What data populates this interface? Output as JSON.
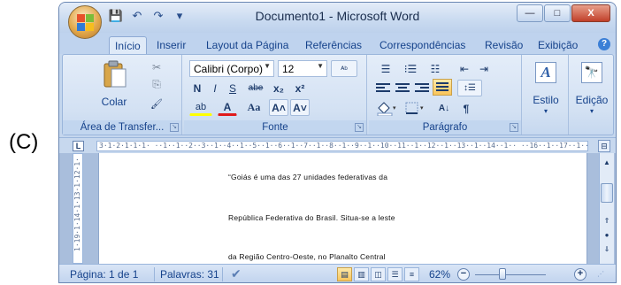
{
  "caption": "(C)",
  "window": {
    "title": "Documento1 - Microsoft Word",
    "minimize": "—",
    "maximize": "□",
    "close": "X"
  },
  "qat": {
    "save": "💾",
    "undo": "↶",
    "redo": "↷",
    "customize": "▾"
  },
  "tabs": [
    "Início",
    "Inserir",
    "Layout da Página",
    "Referências",
    "Correspondências",
    "Revisão",
    "Exibição"
  ],
  "help": "?",
  "clipboard": {
    "paste_label": "Colar",
    "group_label": "Área de Transfer...",
    "cut": "✂",
    "copy": "⎘",
    "format_painter": "🖌"
  },
  "font": {
    "family": "Calibri (Corpo)",
    "size": "12",
    "bold": "N",
    "italic": "I",
    "underline": "S",
    "strike": "abe",
    "subscript": "x₂",
    "superscript": "x²",
    "change_case": "Aa",
    "grow": "A˄",
    "shrink": "A˅",
    "highlight": "ab",
    "font_color": "A",
    "clear": "ᴬᵇ",
    "group_label": "Fonte"
  },
  "paragraph": {
    "group_label": "Parágrafo",
    "bullets": "☰",
    "numbering": "⁝☰",
    "multilevel": "☷",
    "decrease_indent": "⇤",
    "increase_indent": "⇥",
    "sort": "A↓",
    "show_marks": "¶",
    "line_spacing": "↕☰"
  },
  "styles": {
    "label": "Estilo",
    "icon": "A"
  },
  "editing": {
    "label": "Edição",
    "icon": "🔭"
  },
  "ruler": {
    "corner": "L",
    "text": "3·1·2·1·1·1·  ··1··1··2··3··1··4··1··5··1··6··1··7··1··8··1··9··1··10··11··1··12··1··13··1··14··1··  ··16··1··17··1··",
    "toggle": "⊟",
    "vertical_text": "1·19·1·14·1·13·1·12·1·"
  },
  "document": {
    "paragraphs": [
      "“Goiás é uma das 27 unidades federativas da",
      "República Federativa do Brasil. Situa-se a leste",
      "da Região Centro-Oeste, no Planalto Central"
    ]
  },
  "status": {
    "page": "Página: 1 de 1",
    "words": "Palavras: 31",
    "proofing": "✔",
    "zoom": "62%",
    "zoom_value_percent": 62,
    "zoom_out": "−",
    "zoom_in": "+"
  },
  "colors": {
    "ribbon": "#d3e1f3",
    "accent": "#15428b",
    "highlight": "#fde9a9"
  }
}
